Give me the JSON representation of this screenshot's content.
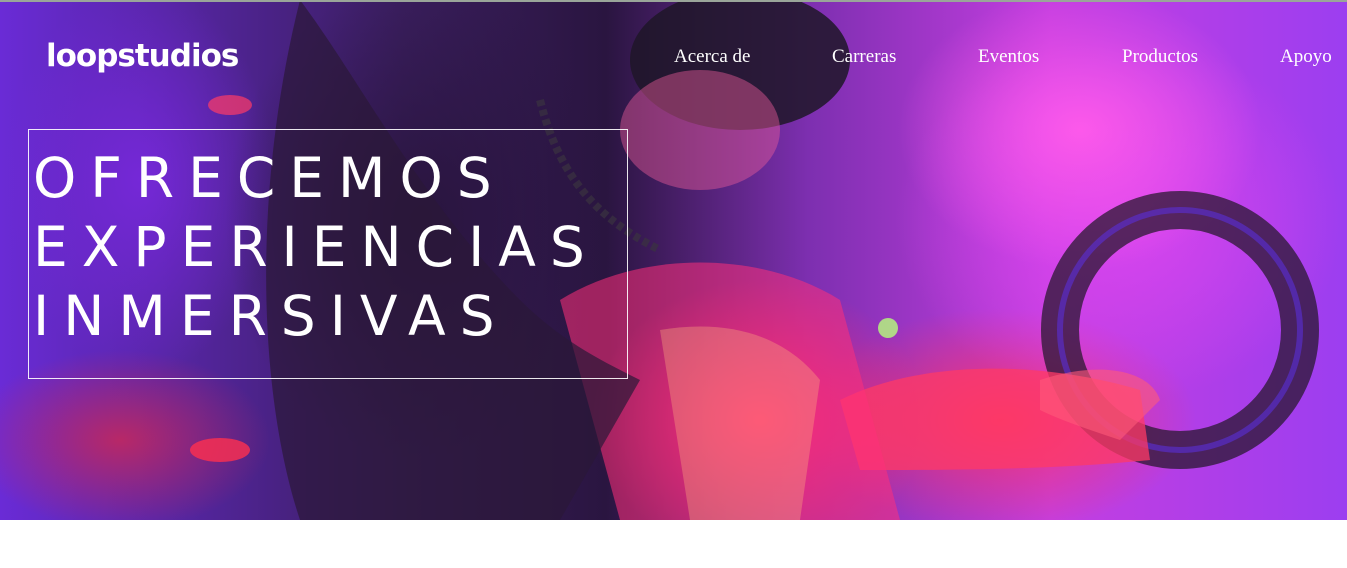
{
  "brand": {
    "logo": "loopstudios"
  },
  "nav": {
    "items": [
      {
        "label": "Acerca de"
      },
      {
        "label": "Carreras"
      },
      {
        "label": "Eventos"
      },
      {
        "label": "Productos"
      },
      {
        "label": "Apoyo"
      }
    ]
  },
  "hero": {
    "headline_lines": [
      "OFRECEMOS",
      "EXPERIENCIAS",
      "INMERSIVAS"
    ],
    "image_description_colors": {
      "magenta": "#ff4fe6",
      "hot_pink": "#ff2f6e",
      "violet": "#7a2fe0",
      "dark_plum": "#2a1540"
    }
  },
  "colors": {
    "text": "#ffffff",
    "page_background": "#ffffff"
  }
}
